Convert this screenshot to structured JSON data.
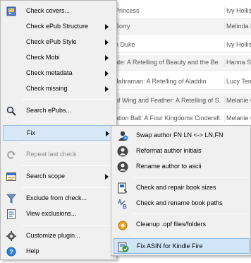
{
  "background_table": {
    "rows": [
      {
        "title": "Princess",
        "author": "Ivy Hollis"
      },
      {
        "title": "Sorry",
        "author": "Melinda Ri"
      },
      {
        "title": "n Duke",
        "author": "Ivy Hollis"
      },
      {
        "title": "ate: A Retelling of Beauty and the Be...",
        "author": "Hanna Sa"
      },
      {
        "title": "Jahraman: A Retelling of Aladdin",
        "author": "Lucy Tem"
      },
      {
        "title": "of Wing and Feather: A Retelling of S...",
        "author": "Melanie C"
      },
      {
        "title": "ation Ball: A Four Kingdoms Cinderell...",
        "author": "Melanie C"
      }
    ]
  },
  "menu": {
    "items": [
      {
        "label": "Check covers...",
        "icon": "book-cover-icon"
      },
      {
        "label": "Check ePub Structure",
        "has_submenu": true
      },
      {
        "label": "Check ePub Style",
        "has_submenu": true
      },
      {
        "label": "Check Mobi",
        "has_submenu": true
      },
      {
        "label": "Check metadata",
        "has_submenu": true
      },
      {
        "label": "Check missing",
        "has_submenu": true
      },
      {
        "label": "Search ePubs...",
        "icon": "magnifier-icon"
      },
      {
        "label": "Fix",
        "has_submenu": true,
        "highlighted": true
      },
      {
        "label": "Repeat last check",
        "icon": "repeat-icon",
        "disabled": true
      },
      {
        "label": "Search scope",
        "icon": "scope-icon",
        "has_submenu": true
      },
      {
        "label": "Exclude from check...",
        "icon": "filter-icon"
      },
      {
        "label": "View exclusions...",
        "icon": "list-icon"
      },
      {
        "label": "Customize plugin...",
        "icon": "gear-icon"
      },
      {
        "label": "Help",
        "icon": "help-icon"
      }
    ]
  },
  "fix_submenu": {
    "items": [
      {
        "label": "Swap author FN LN <-> LN,FN",
        "icon": "swap-author-icon"
      },
      {
        "label": "Reformat author initials",
        "icon": "person-icon"
      },
      {
        "label": "Rename author to ascii",
        "icon": "person-icon"
      },
      {
        "label": "Check and repair book sizes",
        "icon": "book-size-icon"
      },
      {
        "label": "Check and rename book paths",
        "icon": "book-path-icon"
      },
      {
        "label": "Cleanup .opf files/folders",
        "icon": "cleanup-icon"
      },
      {
        "label": "Fix ASIN for Kindle Fire",
        "icon": "kindle-fix-icon",
        "highlighted": true
      }
    ]
  },
  "colors": {
    "menu_bg": "#f0f0f0",
    "highlight_bg": "#d0e5f8",
    "highlight_border": "#7fb3e6",
    "disabled_text": "#8c8c8c"
  }
}
